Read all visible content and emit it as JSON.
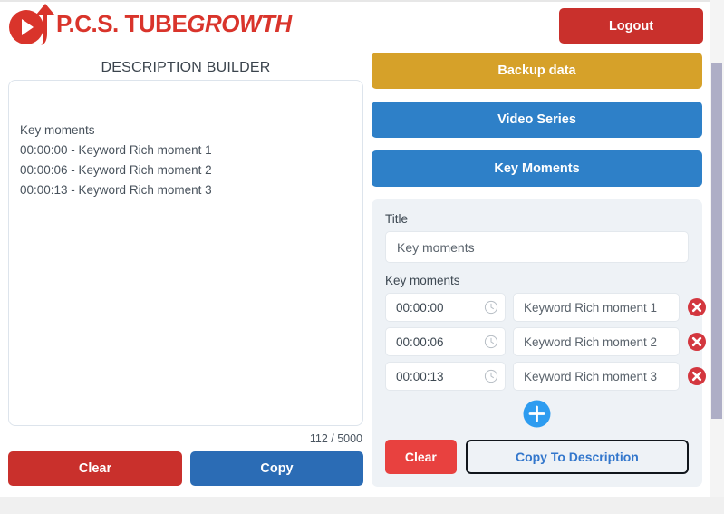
{
  "header": {
    "brand_prefix": "P.C.S. TUBE",
    "brand_suffix": "GROWTH",
    "brand_color": "#d9342b",
    "logout_label": "Logout",
    "logo_icon": "play-arrow-growth-logo"
  },
  "left": {
    "panel_title": "DESCRIPTION BUILDER",
    "description_lines": [
      "Key moments",
      "00:00:00 - Keyword Rich moment 1",
      "00:00:06 - Keyword Rich moment 2",
      "00:00:13 - Keyword Rich moment 3"
    ],
    "char_count": "112 / 5000",
    "clear_label": "Clear",
    "copy_label": "Copy"
  },
  "right": {
    "buttons": [
      {
        "label": "Backup data",
        "color": "#d6a129"
      },
      {
        "label": "Video Series",
        "color": "#2e80c8"
      },
      {
        "label": "Key Moments",
        "color": "#2e80c8"
      }
    ],
    "form": {
      "title_label": "Title",
      "title_value": "Key moments",
      "title_placeholder": "Title",
      "key_moments_label": "Key moments",
      "rows": [
        {
          "time": "00:00:00",
          "text": "Keyword Rich moment 1",
          "time_icon": "clock-icon",
          "delete_icon": "delete-circle-icon"
        },
        {
          "time": "00:00:06",
          "text": "Keyword Rich moment 2",
          "time_icon": "clock-icon",
          "delete_icon": "delete-circle-icon"
        },
        {
          "time": "00:00:13",
          "text": "Keyword Rich moment 3",
          "time_icon": "clock-icon",
          "delete_icon": "delete-circle-icon"
        }
      ],
      "add_icon": "plus-circle-icon",
      "clear_label": "Clear",
      "copy_to_description_label": "Copy To Description"
    }
  }
}
